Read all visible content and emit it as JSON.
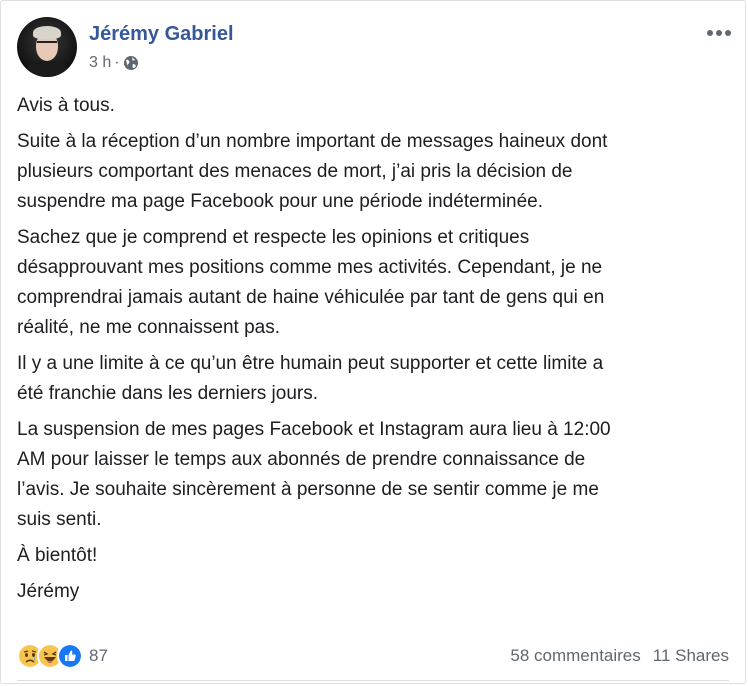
{
  "post": {
    "author": "Jérémy Gabriel",
    "time": "3 h",
    "separator": "·",
    "privacy_icon": "globe-icon",
    "more_icon": "more-options-icon",
    "paragraphs": [
      [
        "Avis à tous."
      ],
      [
        "Suite à la réception d’un nombre important de messages haineux dont",
        "plusieurs comportant des menaces de mort, j’ai pris la décision de",
        "suspendre ma page Facebook pour une période indéterminée."
      ],
      [
        "Sachez que je comprend et respecte les opinions et critiques",
        "désapprouvant mes positions comme mes activités. Cependant, je ne",
        "comprendrai jamais autant de haine véhiculée par tant de gens qui en",
        "réalité, ne me connaissent pas."
      ],
      [
        "Il y a une limite à ce qu’un être humain peut supporter et cette limite a",
        "été franchie dans les derniers jours."
      ],
      [
        "La suspension de mes pages Facebook et Instagram aura lieu à 12:00",
        "AM pour laisser le temps aux abonnés de prendre connaissance de",
        "l’avis. Je souhaite sincèrement à personne de se sentir comme je me",
        "suis senti."
      ],
      [
        "À bientôt!"
      ],
      [
        "Jérémy"
      ]
    ]
  },
  "footer": {
    "reactions": [
      "sad-reaction-icon",
      "haha-reaction-icon",
      "like-reaction-icon"
    ],
    "reaction_count": "87",
    "comments": "58 commentaires",
    "shares": "11 Shares"
  },
  "colors": {
    "author_link": "#365899",
    "secondary_text": "#606770",
    "like_blue": "#1877f2",
    "reaction_yellow": "#f7c44d"
  }
}
